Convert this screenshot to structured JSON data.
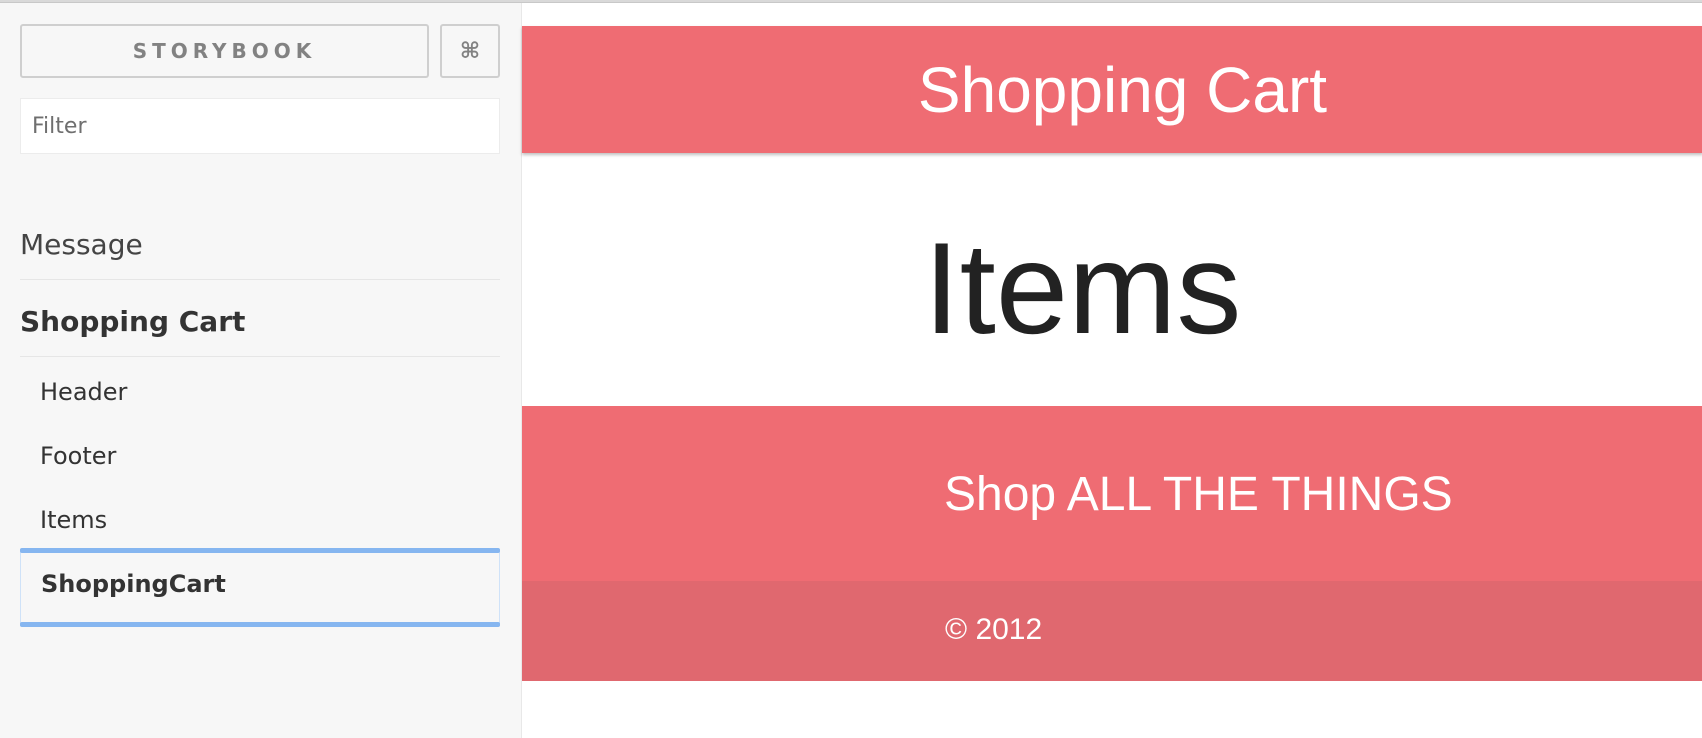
{
  "sidebar": {
    "brand_label": "STORYBOOK",
    "shortcut_icon": "⌘",
    "filter": {
      "placeholder": "Filter",
      "value": ""
    },
    "kinds": [
      {
        "label": "Message",
        "expanded": false
      },
      {
        "label": "Shopping Cart",
        "expanded": true,
        "stories": [
          {
            "label": "Header"
          },
          {
            "label": "Footer"
          },
          {
            "label": "Items"
          },
          {
            "label": "ShoppingCart",
            "selected": true
          }
        ]
      }
    ]
  },
  "preview": {
    "header_title": "Shopping Cart",
    "items_title": "Items",
    "footer_tagline": "Shop ALL THE THINGS",
    "footer_copyright": "© 2012"
  },
  "colors": {
    "accent": "#ef6c73",
    "accent_dark": "#e0686f",
    "selection": "#86b6f0",
    "sidebar_bg": "#f7f7f7"
  }
}
